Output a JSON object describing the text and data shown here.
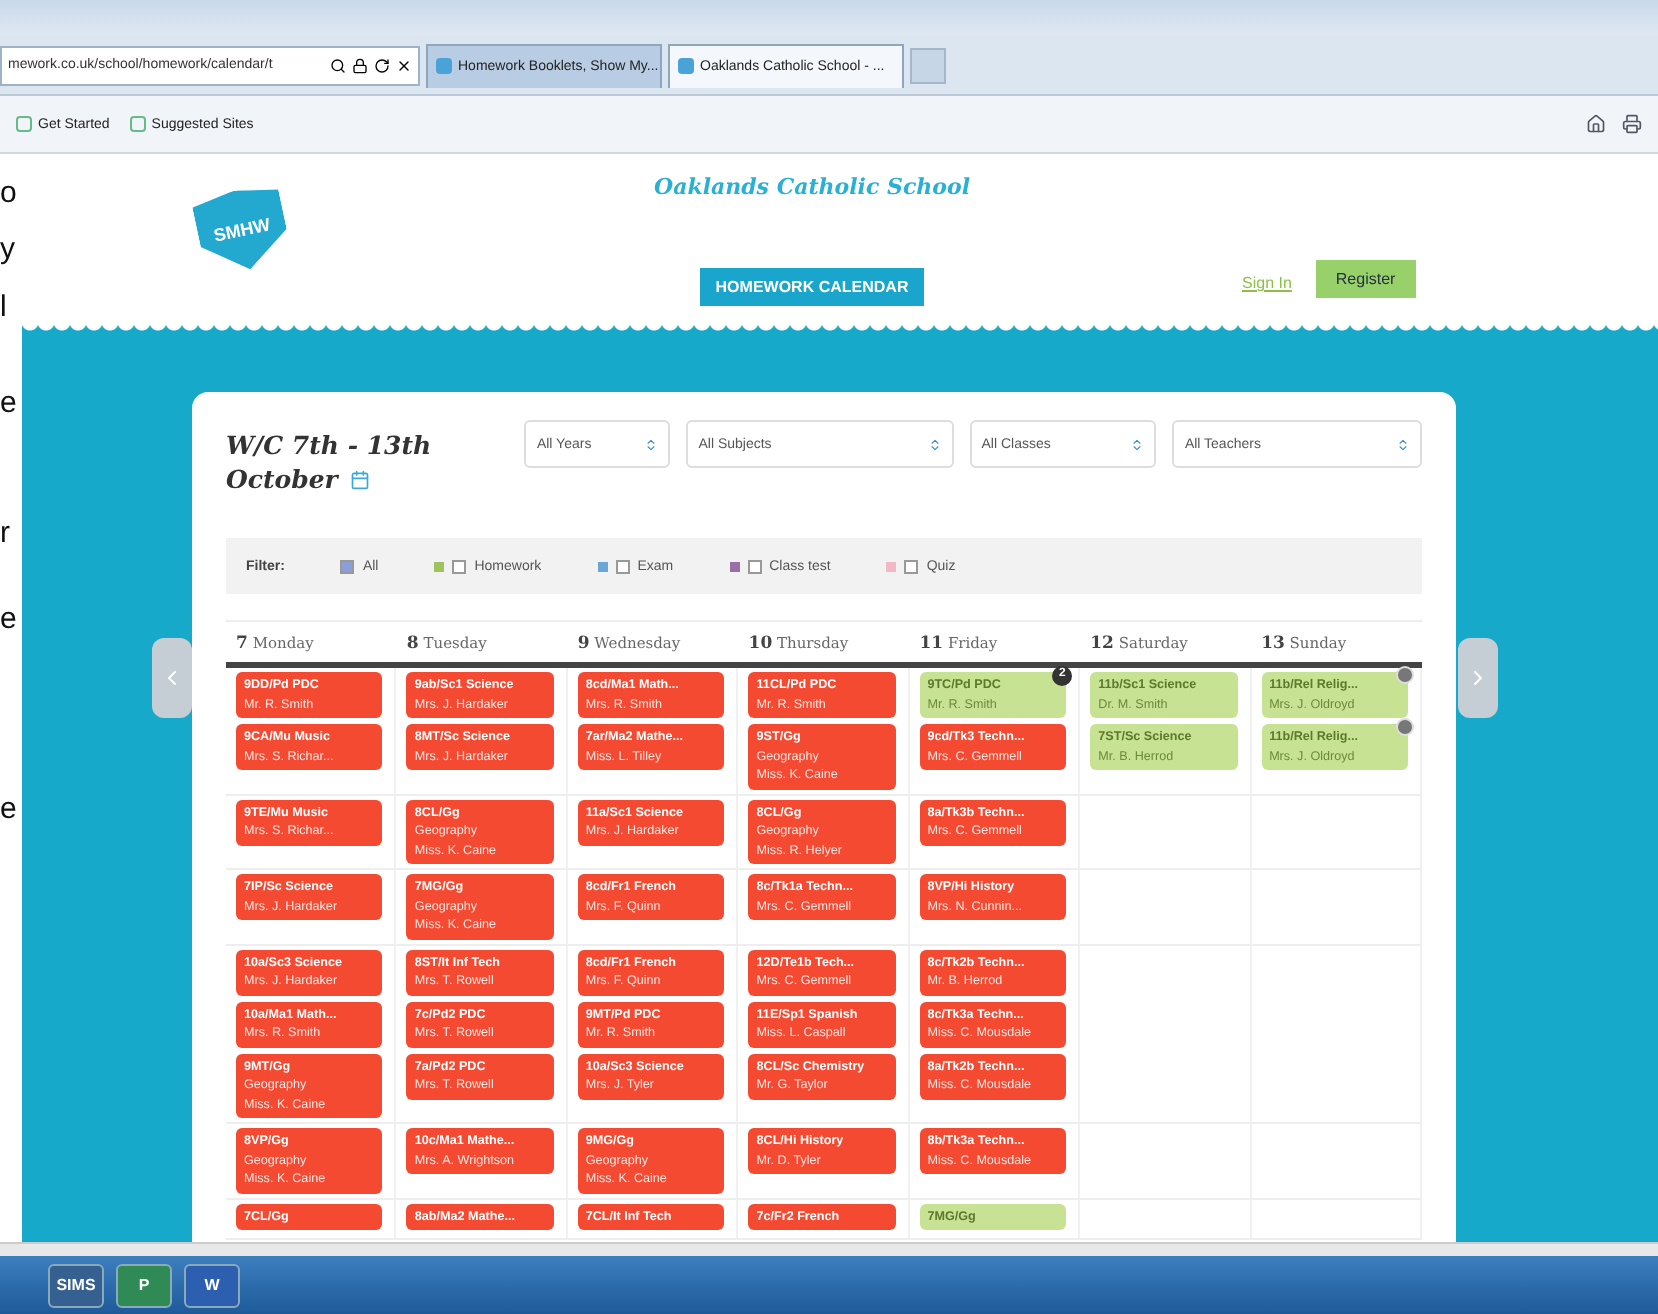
{
  "browser": {
    "address": "mework.co.uk/school/homework/calendar/t",
    "tabs": [
      {
        "label": "Homework Booklets, Show My...",
        "selected": false
      },
      {
        "label": "Oaklands Catholic School - ...",
        "selected": true
      }
    ],
    "favorites": [
      "Get Started",
      "Suggested Sites"
    ]
  },
  "margin_letters": [
    "o",
    "y",
    "l",
    "e",
    "r",
    "e",
    "e"
  ],
  "header": {
    "logo_text": "SMHW",
    "school": "Oaklands Catholic School",
    "calendar_button": "HOMEWORK CALENDAR",
    "sign_in": "Sign In",
    "register": "Register"
  },
  "calendar": {
    "title_line1": "W/C 7th - 13th",
    "title_line2": "October",
    "selects": [
      "All Years",
      "All Subjects",
      "All Classes",
      "All Teachers"
    ],
    "filter_label": "Filter:",
    "filters": [
      {
        "label": "All",
        "checked": true
      },
      {
        "label": "Homework",
        "checked": false,
        "color": "#9cc45a"
      },
      {
        "label": "Exam",
        "checked": false,
        "color": "#6aa6d6"
      },
      {
        "label": "Class test",
        "checked": false,
        "color": "#9a6fa8"
      },
      {
        "label": "Quiz",
        "checked": false,
        "color": "#f2b8c6"
      }
    ],
    "days": [
      {
        "num": "7",
        "name": "Monday"
      },
      {
        "num": "8",
        "name": "Tuesday"
      },
      {
        "num": "9",
        "name": "Wednesday"
      },
      {
        "num": "10",
        "name": "Thursday"
      },
      {
        "num": "11",
        "name": "Friday"
      },
      {
        "num": "12",
        "name": "Saturday"
      },
      {
        "num": "13",
        "name": "Sunday"
      }
    ],
    "rows": [
      [
        [
          {
            "lines": [
              "9DD/Pd PDC",
              "Mr. R. Smith"
            ],
            "color": "#f44a32"
          },
          {
            "lines": [
              "9CA/Mu Music",
              "Mrs. S. Richar..."
            ],
            "color": "#f44a32"
          }
        ],
        [
          {
            "lines": [
              "9ab/Sc1 Science",
              "Mrs. J. Hardaker"
            ],
            "color": "#f44a32"
          },
          {
            "lines": [
              "8MT/Sc Science",
              "Mrs. J. Hardaker"
            ],
            "color": "#f44a32"
          }
        ],
        [
          {
            "lines": [
              "8cd/Ma1 Math...",
              "Mrs. R. Smith"
            ],
            "color": "#f44a32"
          },
          {
            "lines": [
              "7ar/Ma2 Mathe...",
              "Miss. L. Tilley"
            ],
            "color": "#f44a32"
          }
        ],
        [
          {
            "lines": [
              "11CL/Pd PDC",
              "Mr. R. Smith"
            ],
            "color": "#f44a32"
          },
          {
            "lines": [
              "9ST/Gg",
              "Geography",
              "Miss. K. Caine"
            ],
            "color": "#f44a32"
          }
        ],
        [
          {
            "lines": [
              "9TC/Pd PDC",
              "Mr. R. Smith"
            ],
            "color": "#c8e294",
            "badge": "2"
          },
          {
            "lines": [
              "9cd/Tk3 Techn...",
              "Mrs. C. Gemmell"
            ],
            "color": "#f44a32"
          }
        ],
        [
          {
            "lines": [
              "11b/Sc1 Science",
              "Dr. M. Smith"
            ],
            "color": "#c8e294"
          },
          {
            "lines": [
              "7ST/Sc Science",
              "Mr. B. Herrod"
            ],
            "color": "#c8e294"
          }
        ],
        [
          {
            "lines": [
              "11b/Rel Relig...",
              "Mrs. J. Oldroyd"
            ],
            "color": "#c8e294",
            "marked": true
          },
          {
            "lines": [
              "11b/Rel Relig...",
              "Mrs. J. Oldroyd"
            ],
            "color": "#c8e294",
            "marked": true
          }
        ]
      ],
      [
        [
          {
            "lines": [
              "9TE/Mu Music",
              "Mrs. S. Richar..."
            ],
            "color": "#f44a32"
          }
        ],
        [
          {
            "lines": [
              "8CL/Gg",
              "Geography",
              "Miss. K. Caine"
            ],
            "color": "#f44a32"
          }
        ],
        [
          {
            "lines": [
              "11a/Sc1 Science",
              "Mrs. J. Hardaker"
            ],
            "color": "#f44a32"
          }
        ],
        [
          {
            "lines": [
              "8CL/Gg",
              "Geography",
              "Miss. R. Helyer"
            ],
            "color": "#f44a32"
          }
        ],
        [
          {
            "lines": [
              "8a/Tk3b Techn...",
              "Mrs. C. Gemmell"
            ],
            "color": "#f44a32"
          }
        ],
        [],
        []
      ],
      [
        [
          {
            "lines": [
              "7IP/Sc Science",
              "Mrs. J. Hardaker"
            ],
            "color": "#f44a32"
          }
        ],
        [
          {
            "lines": [
              "7MG/Gg",
              "Geography",
              "Miss. K. Caine"
            ],
            "color": "#f44a32"
          }
        ],
        [
          {
            "lines": [
              "8cd/Fr1 French",
              "Mrs. F. Quinn"
            ],
            "color": "#f44a32"
          }
        ],
        [
          {
            "lines": [
              "8c/Tk1a Techn...",
              "Mrs. C. Gemmell"
            ],
            "color": "#f44a32"
          }
        ],
        [
          {
            "lines": [
              "8VP/Hi History",
              "Mrs. N. Cunnin..."
            ],
            "color": "#f44a32"
          }
        ],
        [],
        []
      ],
      [
        [
          {
            "lines": [
              "10a/Sc3 Science",
              "Mrs. J. Hardaker"
            ],
            "color": "#f44a32"
          },
          {
            "lines": [
              "10a/Ma1 Math...",
              "Mrs. R. Smith"
            ],
            "color": "#f44a32"
          },
          {
            "lines": [
              "9MT/Gg",
              "Geography",
              "Miss. K. Caine"
            ],
            "color": "#f44a32"
          }
        ],
        [
          {
            "lines": [
              "8ST/It Inf Tech",
              "Mrs. T. Rowell"
            ],
            "color": "#f44a32"
          },
          {
            "lines": [
              "7c/Pd2 PDC",
              "Mrs. T. Rowell"
            ],
            "color": "#f44a32"
          },
          {
            "lines": [
              "7a/Pd2 PDC",
              "Mrs. T. Rowell"
            ],
            "color": "#f44a32"
          }
        ],
        [
          {
            "lines": [
              "8cd/Fr1 French",
              "Mrs. F. Quinn"
            ],
            "color": "#f44a32"
          },
          {
            "lines": [
              "9MT/Pd PDC",
              "Mr. R. Smith"
            ],
            "color": "#f44a32"
          },
          {
            "lines": [
              "10a/Sc3 Science",
              "Mrs. J. Tyler"
            ],
            "color": "#f44a32"
          }
        ],
        [
          {
            "lines": [
              "12D/Te1b Tech...",
              "Mrs. C. Gemmell"
            ],
            "color": "#f44a32"
          },
          {
            "lines": [
              "11E/Sp1 Spanish",
              "Miss. L. Caspall"
            ],
            "color": "#f44a32"
          },
          {
            "lines": [
              "8CL/Sc Chemistry",
              "Mr. G. Taylor"
            ],
            "color": "#f44a32"
          }
        ],
        [
          {
            "lines": [
              "8c/Tk2b Techn...",
              "Mr. B. Herrod"
            ],
            "color": "#f44a32"
          },
          {
            "lines": [
              "8c/Tk3a Techn...",
              "Miss. C. Mousdale"
            ],
            "color": "#f44a32"
          },
          {
            "lines": [
              "8a/Tk2b Techn...",
              "Miss. C. Mousdale"
            ],
            "color": "#f44a32"
          }
        ],
        [],
        []
      ],
      [
        [
          {
            "lines": [
              "8VP/Gg",
              "Geography",
              "Miss. K. Caine"
            ],
            "color": "#f44a32"
          }
        ],
        [
          {
            "lines": [
              "10c/Ma1 Mathe...",
              "Mrs. A. Wrightson"
            ],
            "color": "#f44a32"
          }
        ],
        [
          {
            "lines": [
              "9MG/Gg",
              "Geography",
              "Miss. K. Caine"
            ],
            "color": "#f44a32"
          }
        ],
        [
          {
            "lines": [
              "8CL/Hi History",
              "Mr. D. Tyler"
            ],
            "color": "#f44a32"
          }
        ],
        [
          {
            "lines": [
              "8b/Tk3a Techn...",
              "Miss. C. Mousdale"
            ],
            "color": "#f44a32"
          }
        ],
        [],
        []
      ],
      [
        [
          {
            "lines": [
              "7CL/Gg"
            ],
            "color": "#f44a32"
          }
        ],
        [
          {
            "lines": [
              "8ab/Ma2 Mathe..."
            ],
            "color": "#f44a32"
          }
        ],
        [
          {
            "lines": [
              "7CL/It Inf Tech"
            ],
            "color": "#f44a32"
          }
        ],
        [
          {
            "lines": [
              "7c/Fr2 French"
            ],
            "color": "#f44a32"
          }
        ],
        [
          {
            "lines": [
              "7MG/Gg"
            ],
            "color": "#c8e294"
          }
        ],
        [],
        []
      ]
    ]
  },
  "taskbar": [
    "SIMS",
    "P",
    "W"
  ]
}
